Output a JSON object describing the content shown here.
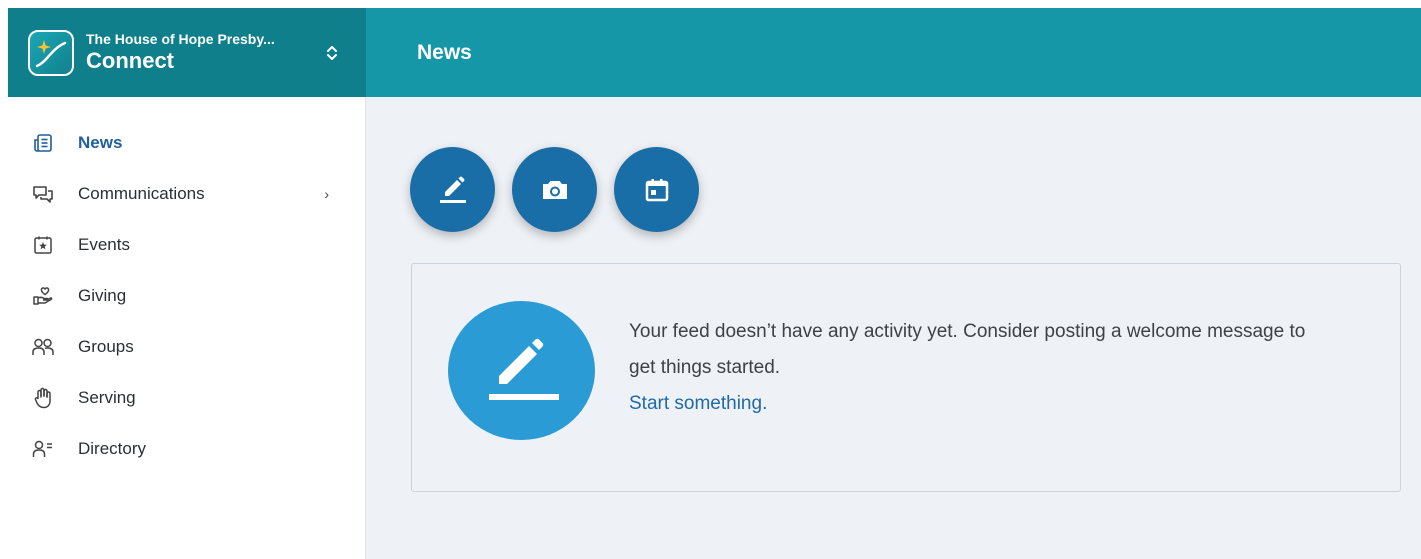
{
  "brand": {
    "org_name": "The House of Hope Presby...",
    "app_name": "Connect",
    "logo_icon": "sparkle-mountain-logo",
    "switch_icon": "chevron-updown-icon"
  },
  "topbar": {
    "title": "News"
  },
  "sidebar": {
    "items": [
      {
        "label": "News",
        "icon": "newspaper-icon",
        "active": true
      },
      {
        "label": "Communications",
        "icon": "chat-bubbles-icon",
        "has_submenu": true
      },
      {
        "label": "Events",
        "icon": "calendar-star-icon"
      },
      {
        "label": "Giving",
        "icon": "hand-heart-icon"
      },
      {
        "label": "Groups",
        "icon": "people-icon"
      },
      {
        "label": "Serving",
        "icon": "raised-hand-icon"
      },
      {
        "label": "Directory",
        "icon": "person-list-icon"
      }
    ],
    "submenu_chevron": "›"
  },
  "actions": [
    {
      "name": "write-post",
      "icon": "pencil-icon"
    },
    {
      "name": "photo-post",
      "icon": "camera-icon"
    },
    {
      "name": "event-post",
      "icon": "calendar-icon"
    }
  ],
  "feed": {
    "empty_message": "Your feed doesn’t have any activity yet. Consider posting a welcome message to get things started.",
    "cta_link": "Start something."
  },
  "colors": {
    "brand_bg": "#0f7f8c",
    "topbar_bg": "#1597a8",
    "action_button": "#1a6ea8",
    "illustration": "#2b9bd6",
    "active_nav": "#1f5f9a",
    "link": "#1f6aa6",
    "main_bg": "#eef1f5"
  }
}
